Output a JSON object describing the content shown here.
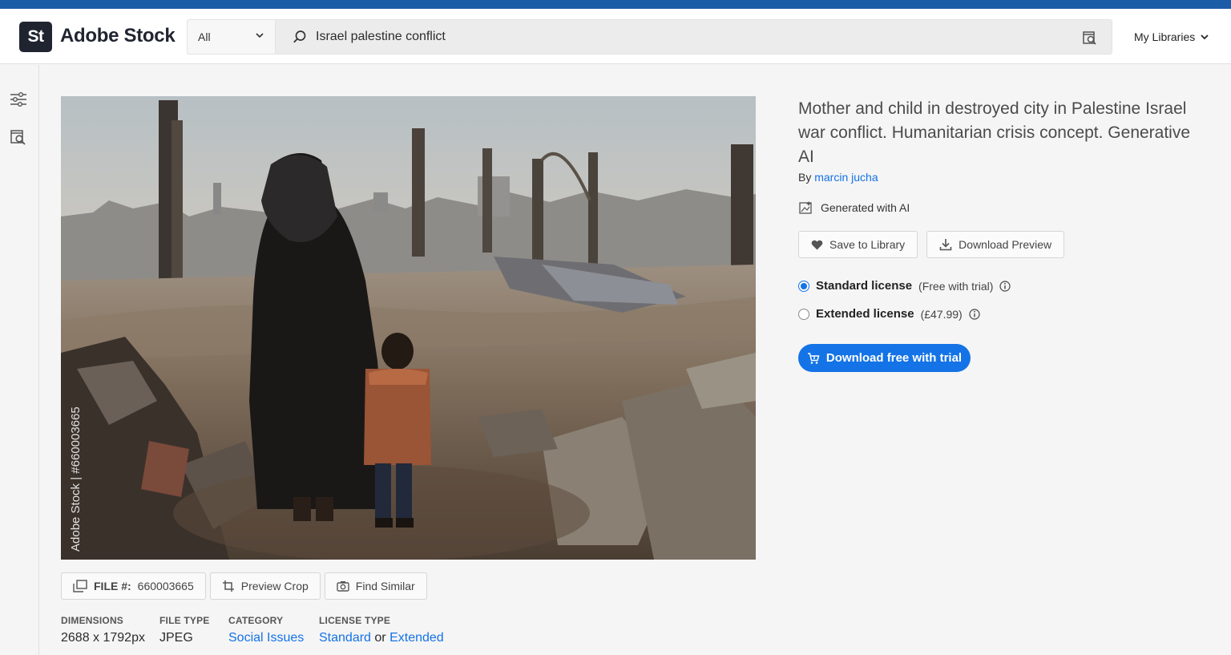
{
  "app": {
    "logo_mark": "St",
    "name": "Adobe Stock"
  },
  "search": {
    "scope": "All",
    "query": "Israel palestine conflict"
  },
  "header": {
    "my_libraries": "My Libraries"
  },
  "sidebar": {
    "icons": [
      "filter-sliders-icon",
      "visual-search-icon"
    ]
  },
  "image": {
    "watermark": "Adobe Stock | #660003665",
    "file_label": "FILE #:",
    "file_number": "660003665",
    "preview_crop": "Preview Crop",
    "find_similar": "Find Similar"
  },
  "meta": {
    "dimensions_label": "DIMENSIONS",
    "dimensions_value": "2688 x 1792px",
    "file_type_label": "FILE TYPE",
    "file_type_value": "JPEG",
    "category_label": "CATEGORY",
    "category_value": "Social Issues",
    "license_type_label": "LICENSE TYPE",
    "license_standard": "Standard",
    "license_or": "or",
    "license_extended": "Extended"
  },
  "details": {
    "title": "Mother and child in destroyed city in Palestine Israel war conflict. Humanitarian crisis concept. Generative AI",
    "by": "By",
    "author": "marcin jucha",
    "ai_label": "Generated with AI",
    "save_to_library": "Save to Library",
    "download_preview": "Download Preview",
    "standard_license": "Standard license",
    "standard_note": "(Free with trial)",
    "extended_license": "Extended license",
    "extended_note": "(£47.99)",
    "cta": "Download free with trial"
  },
  "colors": {
    "accent": "#1473e6",
    "topbar": "#1b5ca6",
    "logo_bg": "#1f2430"
  }
}
